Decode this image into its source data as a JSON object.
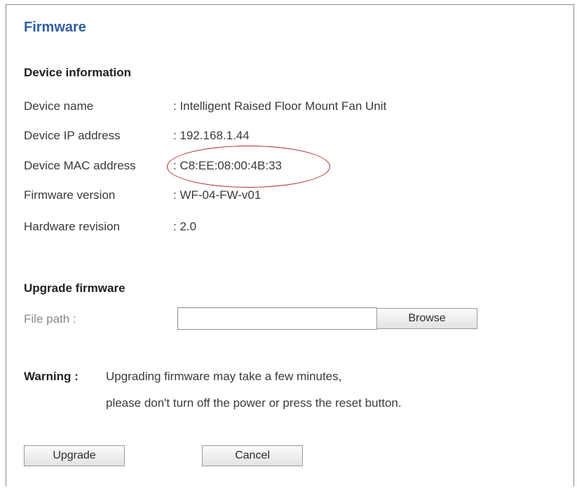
{
  "title": "Firmware",
  "device_info": {
    "heading": "Device information",
    "rows": [
      {
        "label": "Device name",
        "value": ": Intelligent Raised Floor Mount Fan Unit"
      },
      {
        "label": "Device IP address",
        "value": ": 192.168.1.44"
      },
      {
        "label": "Device MAC address",
        "value": ": C8:EE:08:00:4B:33"
      },
      {
        "label": "Firmware version",
        "value": ": WF-04-FW-v01"
      },
      {
        "label": "Hardware revision",
        "value": ": 2.0"
      }
    ]
  },
  "upgrade": {
    "heading": "Upgrade firmware",
    "file_label": "File path :",
    "file_value": "",
    "browse_label": "Browse"
  },
  "warning": {
    "label": "Warning :",
    "line1": "Upgrading firmware may take a few minutes,",
    "line2": "please don't turn off the power or press the reset button."
  },
  "actions": {
    "upgrade_label": "Upgrade",
    "cancel_label": "Cancel"
  },
  "colors": {
    "title": "#2e5f9e",
    "highlight": "#b3262d"
  }
}
